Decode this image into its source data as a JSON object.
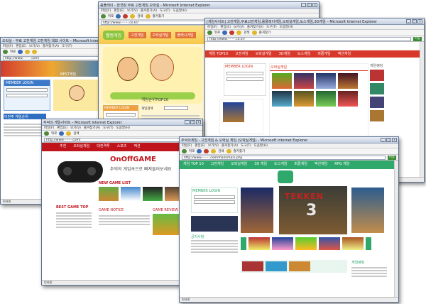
{
  "menu": [
    "파일(F)",
    "편집(E)",
    "보기(V)",
    "즐겨찾기(A)",
    "도구(T)",
    "도움말(H)"
  ],
  "toolbar": {
    "back": "뒤로",
    "search": "검색",
    "favorites": "즐겨찾기",
    "go": "이동",
    "links": "연결"
  },
  "status": "인터넷",
  "windows": {
    "w1": {
      "title": "오락실 - 무료 고전게임 고전게임 대표 사이트 – Microsoft Internet Explorer",
      "address": "http://www.·······.com/",
      "nav_text": "BEST게임",
      "login": "MEMBER LOGIN",
      "banner": "이번주 게임순위"
    },
    "w2": {
      "title": "롤플레이 - 한국판 무료 고전게임 오락실 - Microsoft Internet Explorer",
      "address": "http://www.·······.co.kr/",
      "logo": "웰컴게임",
      "ranking": "게임순위TOP10",
      "login": "MEMBER LOGIN",
      "game_search": "게임검색",
      "tabs": [
        "고전게임",
        "오락실게임",
        "플래시게임",
        "스포츠",
        "액션"
      ]
    },
    "w3": {
      "title": "[게임사이트] 고전게임,무료고전게임,롤플레이게임,오락실게임,도스게임,3D게임 – Microsoft Internet Explorer",
      "address": "http://www.·······.co.kr/",
      "nav": [
        "게임 TOP10",
        "고전게임",
        "오락실게임",
        "3D게임",
        "도스게임",
        "퍼즐게임",
        "액션게임"
      ],
      "login": "MEMBER LOGIN",
      "hot": "오락실게임",
      "side": "게임랭킹"
    },
    "w4": {
      "title": "추억의 게임사이트 – Microsoft Internet Explorer",
      "address": "http://www.·······.com/",
      "nav": [
        "추천",
        "오락실게임",
        "대전격투",
        "스포츠",
        "액션"
      ],
      "logo": "OnOffGAME",
      "slogan": "추억의 게임속으로 빠져들어보세요",
      "new_game": "NEW GAME LIST",
      "best": "BEST GAME TOP",
      "notice": "GAME NOTICE",
      "review": "GAME REVIEW"
    },
    "w5": {
      "title": "추억의게임 - 고전게임 & 오락실 게임 (오락실게임) - Microsoft Internet Explorer",
      "address": "http://www.·······.com/main/main.php",
      "nav": [
        "게임 TOP 10",
        "고전게임",
        "오락실게임",
        "3D 게임",
        "3D 게임",
        "도스게임",
        "퍼즐게임",
        "액션게임",
        "RPG 게임",
        "스포츠"
      ],
      "login": "MEMBER LOGIN",
      "feature_title": "TEKKEN",
      "feature_num": "3",
      "notice": "공지사항",
      "ranking": "게임랭킹"
    }
  },
  "colors": {
    "titlebar": "#c4cfe0",
    "w3_red": "#d8382a",
    "w4_red": "#c0141c",
    "w5_green": "#2fa86c"
  }
}
